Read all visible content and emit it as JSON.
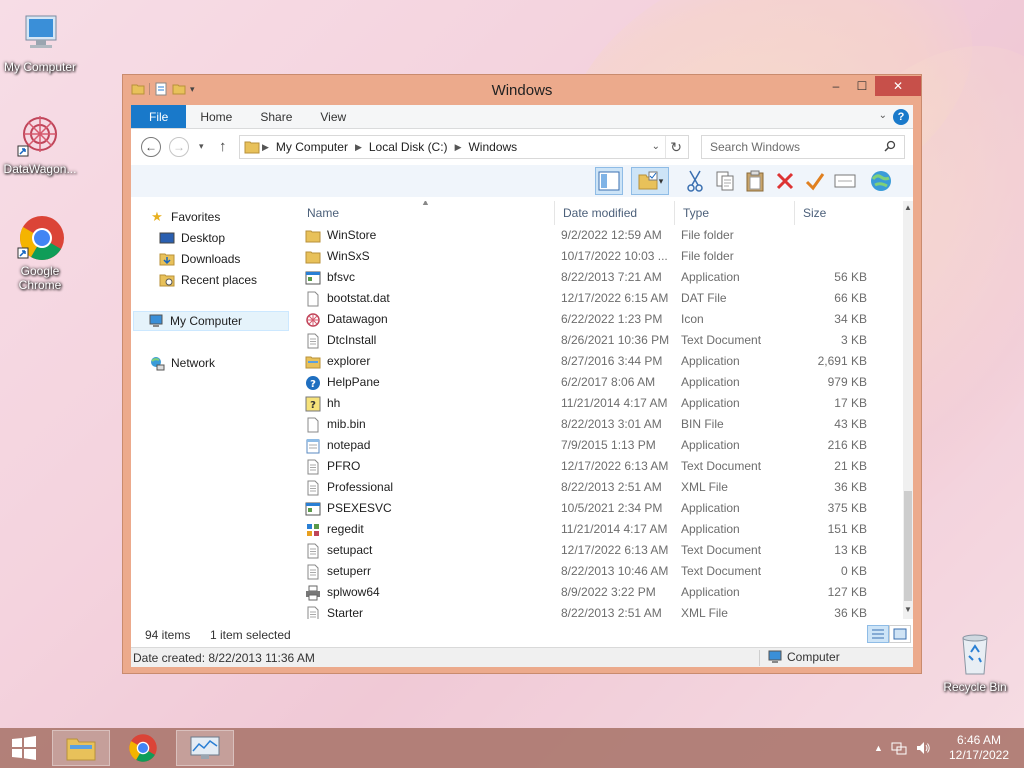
{
  "desktop": {
    "icons": [
      {
        "label": "My Computer"
      },
      {
        "label": "DataWagon..."
      },
      {
        "label": "Google Chrome"
      },
      {
        "label": "Recycle Bin"
      }
    ]
  },
  "window": {
    "title": "Windows",
    "controls": {
      "minimize": "–",
      "maximize": "☐",
      "close": "✕"
    },
    "ribbon_tabs": [
      "File",
      "Home",
      "Share",
      "View"
    ],
    "help": "?"
  },
  "addressbar": {
    "back": "←",
    "forward": "→",
    "up": "↑",
    "crumbs": [
      "My Computer",
      "Local Disk (C:)",
      "Windows"
    ],
    "search_placeholder": "Search Windows"
  },
  "navpane": {
    "favorites": "Favorites",
    "items": [
      "Desktop",
      "Downloads",
      "Recent places"
    ],
    "computer": "My Computer",
    "network": "Network"
  },
  "columns": {
    "name": "Name",
    "date": "Date modified",
    "type": "Type",
    "size": "Size"
  },
  "files": [
    {
      "name": "WinStore",
      "date": "9/2/2022 12:59 AM",
      "type": "File folder",
      "size": "",
      "icon": "folder-icon"
    },
    {
      "name": "WinSxS",
      "date": "10/17/2022 10:03 ...",
      "type": "File folder",
      "size": "",
      "icon": "folder-icon"
    },
    {
      "name": "bfsvc",
      "date": "8/22/2013 7:21 AM",
      "type": "Application",
      "size": "56 KB",
      "icon": "app-icon"
    },
    {
      "name": "bootstat.dat",
      "date": "12/17/2022 6:15 AM",
      "type": "DAT File",
      "size": "66 KB",
      "icon": "file-icon"
    },
    {
      "name": "Datawagon",
      "date": "6/22/2022 1:23 PM",
      "type": "Icon",
      "size": "34 KB",
      "icon": "datawagon-icon"
    },
    {
      "name": "DtcInstall",
      "date": "8/26/2021 10:36 PM",
      "type": "Text Document",
      "size": "3 KB",
      "icon": "text-icon"
    },
    {
      "name": "explorer",
      "date": "8/27/2016 3:44 PM",
      "type": "Application",
      "size": "2,691 KB",
      "icon": "explorer-icon"
    },
    {
      "name": "HelpPane",
      "date": "6/2/2017 8:06 AM",
      "type": "Application",
      "size": "979 KB",
      "icon": "help-icon"
    },
    {
      "name": "hh",
      "date": "11/21/2014 4:17 AM",
      "type": "Application",
      "size": "17 KB",
      "icon": "hh-icon"
    },
    {
      "name": "mib.bin",
      "date": "8/22/2013 3:01 AM",
      "type": "BIN File",
      "size": "43 KB",
      "icon": "file-icon"
    },
    {
      "name": "notepad",
      "date": "7/9/2015 1:13 PM",
      "type": "Application",
      "size": "216 KB",
      "icon": "notepad-icon"
    },
    {
      "name": "PFRO",
      "date": "12/17/2022 6:13 AM",
      "type": "Text Document",
      "size": "21 KB",
      "icon": "text-icon"
    },
    {
      "name": "Professional",
      "date": "8/22/2013 2:51 AM",
      "type": "XML File",
      "size": "36 KB",
      "icon": "text-icon"
    },
    {
      "name": "PSEXESVC",
      "date": "10/5/2021 2:34 PM",
      "type": "Application",
      "size": "375 KB",
      "icon": "app-icon"
    },
    {
      "name": "regedit",
      "date": "11/21/2014 4:17 AM",
      "type": "Application",
      "size": "151 KB",
      "icon": "regedit-icon"
    },
    {
      "name": "setupact",
      "date": "12/17/2022 6:13 AM",
      "type": "Text Document",
      "size": "13 KB",
      "icon": "text-icon"
    },
    {
      "name": "setuperr",
      "date": "8/22/2013 10:46 AM",
      "type": "Text Document",
      "size": "0 KB",
      "icon": "text-icon"
    },
    {
      "name": "splwow64",
      "date": "8/9/2022 3:22 PM",
      "type": "Application",
      "size": "127 KB",
      "icon": "printer-icon"
    },
    {
      "name": "Starter",
      "date": "8/22/2013 2:51 AM",
      "type": "XML File",
      "size": "36 KB",
      "icon": "text-icon"
    }
  ],
  "status": {
    "count": "94 items",
    "selected": "1 item selected"
  },
  "details": {
    "created": "Date created: 8/22/2013 11:36 AM",
    "location": "Computer"
  },
  "taskbar": {
    "time": "6:46 AM",
    "date": "12/17/2022"
  }
}
